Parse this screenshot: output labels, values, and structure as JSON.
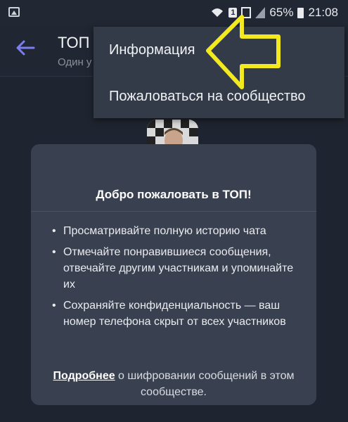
{
  "statusbar": {
    "battery": "65%",
    "time": "21:08",
    "sim_badge": "1"
  },
  "header": {
    "back_icon": "back-arrow-icon",
    "title": "ТОП",
    "subtitle": "Один у"
  },
  "menu": {
    "items": [
      {
        "label": "Информация"
      },
      {
        "label": "Пожаловаться на сообщество"
      }
    ]
  },
  "card": {
    "title": "Добро пожаловать в ТОП!",
    "bullets": [
      "Просматривайте полную историю чата",
      "Отмечайте понравившиеся сообщения, отвечайте другим участникам и упоминайте их",
      "Сохраняйте конфиденциальность — ваш номер телефона скрыт от всех участников"
    ],
    "footer_link": "Подробнее",
    "footer_text": " о шифровании сообщений в этом сообществе."
  },
  "colors": {
    "background": "#1f2530",
    "card": "#394150",
    "menu": "#343b48",
    "accent": "#7b7ff0",
    "annotation": "#f2ea1f"
  }
}
